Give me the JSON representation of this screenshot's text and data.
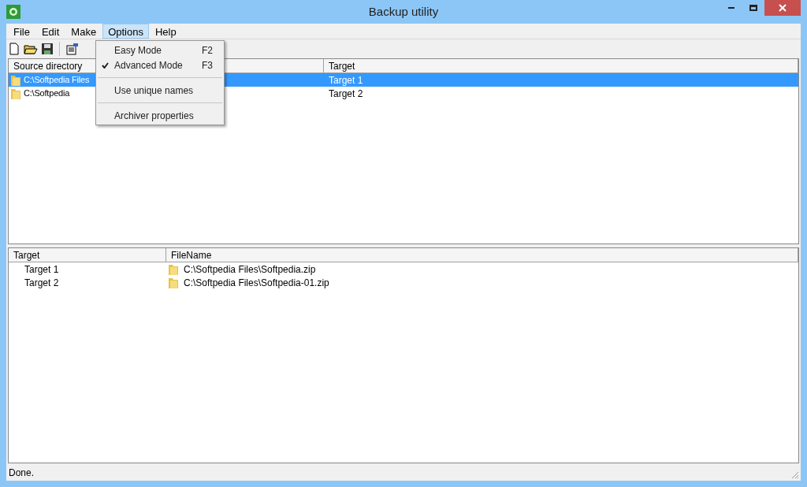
{
  "window": {
    "title": "Backup utility"
  },
  "menu_bar": [
    {
      "label": "File",
      "selected": false
    },
    {
      "label": "Edit",
      "selected": false
    },
    {
      "label": "Make",
      "selected": false
    },
    {
      "label": "Options",
      "selected": true
    },
    {
      "label": "Help",
      "selected": false
    }
  ],
  "options_menu": [
    {
      "kind": "item",
      "label": "Easy Mode",
      "shortcut": "F2",
      "checked": false
    },
    {
      "kind": "item",
      "label": "Advanced Mode",
      "shortcut": "F3",
      "checked": true
    },
    {
      "kind": "separator"
    },
    {
      "kind": "item",
      "label": "Use unique names",
      "checked": false
    },
    {
      "kind": "separator"
    },
    {
      "kind": "item",
      "label": "Archiver properties",
      "checked": false
    }
  ],
  "sources": {
    "columns": [
      "Source directory",
      "Target"
    ],
    "rows": [
      {
        "source": "C:\\Softpedia Files",
        "target": "Target 1",
        "selected": true
      },
      {
        "source": "C:\\Softpedia",
        "target": "Target 2",
        "selected": false
      }
    ]
  },
  "archives": {
    "columns": [
      "Target",
      "FileName"
    ],
    "rows": [
      {
        "target": "Target 1",
        "file": "C:\\Softpedia Files\\Softpedia.zip"
      },
      {
        "target": "Target 2",
        "file": "C:\\Softpedia Files\\Softpedia-01.zip"
      }
    ]
  },
  "status_bar": "Done."
}
